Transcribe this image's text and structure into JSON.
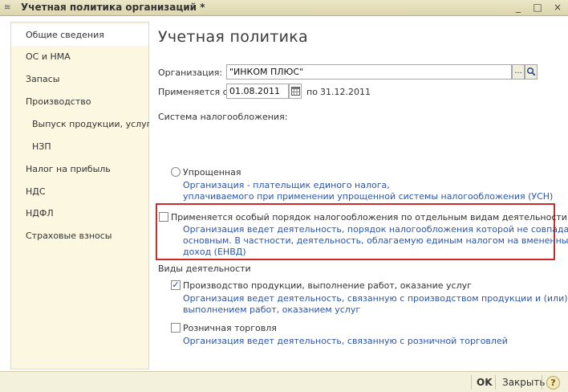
{
  "window": {
    "title": "Учетная политика организаций *",
    "minimize": "_",
    "maximize": "□",
    "close": "×"
  },
  "sidebar": {
    "items": [
      {
        "label": "Общие сведения",
        "active": true
      },
      {
        "label": "ОС и НМА"
      },
      {
        "label": "Запасы"
      },
      {
        "label": "Производство"
      },
      {
        "label": "Выпуск продукции, услуг"
      },
      {
        "label": "НЗП"
      },
      {
        "label": "Налог на прибыль"
      },
      {
        "label": "НДС"
      },
      {
        "label": "НДФЛ"
      },
      {
        "label": "Страховые взносы"
      }
    ]
  },
  "main": {
    "title": "Учетная политика",
    "org_label": "Организация:",
    "org_value": "\"ИНКОМ ПЛЮС\"",
    "org_select_btn": "...",
    "applies_label": "Применяется с:",
    "applies_value": "01.08.2011",
    "to_label": "по",
    "to_value": "31.12.2011",
    "tax_system_label": "Система налогообложения:",
    "simplified": {
      "label": "Упрощенная",
      "selected": false,
      "desc_line1": "Организация - плательщик единого налога,",
      "desc_line2": "уплачиваемого при применении упрощенной системы налогообложения (УСН)"
    },
    "special": {
      "label": "Применяется особый порядок налогообложения по отдельным видам деятельности",
      "checked": false,
      "desc_line1": "Организация ведет деятельность, порядок налогообложения которой не совпадает с",
      "desc_line2": "основным. В частности, деятельность, облагаемую единым налогом на вмененный",
      "desc_line3": "доход (ЕНВД)"
    },
    "activities_label": "Виды деятельности",
    "production": {
      "label": "Производство  продукции, выполнение работ, оказание услуг",
      "checked": true,
      "check_mark": "✓",
      "desc_line1": "Организация ведет деятельность, связанную с производством продукции и (или)",
      "desc_line2": "выполнением работ, оказанием услуг"
    },
    "retail": {
      "label": "Розничная торговля",
      "checked": false,
      "desc_line1": "Организация ведет деятельность, связанную с розничной торговлей"
    }
  },
  "footer": {
    "ok": "OK",
    "close": "Закрыть",
    "help": "?"
  },
  "colors": {
    "accent_text": "#2a56a8",
    "highlight_border": "#cc2b2b",
    "sidebar_bg": "#fbf7e1"
  }
}
